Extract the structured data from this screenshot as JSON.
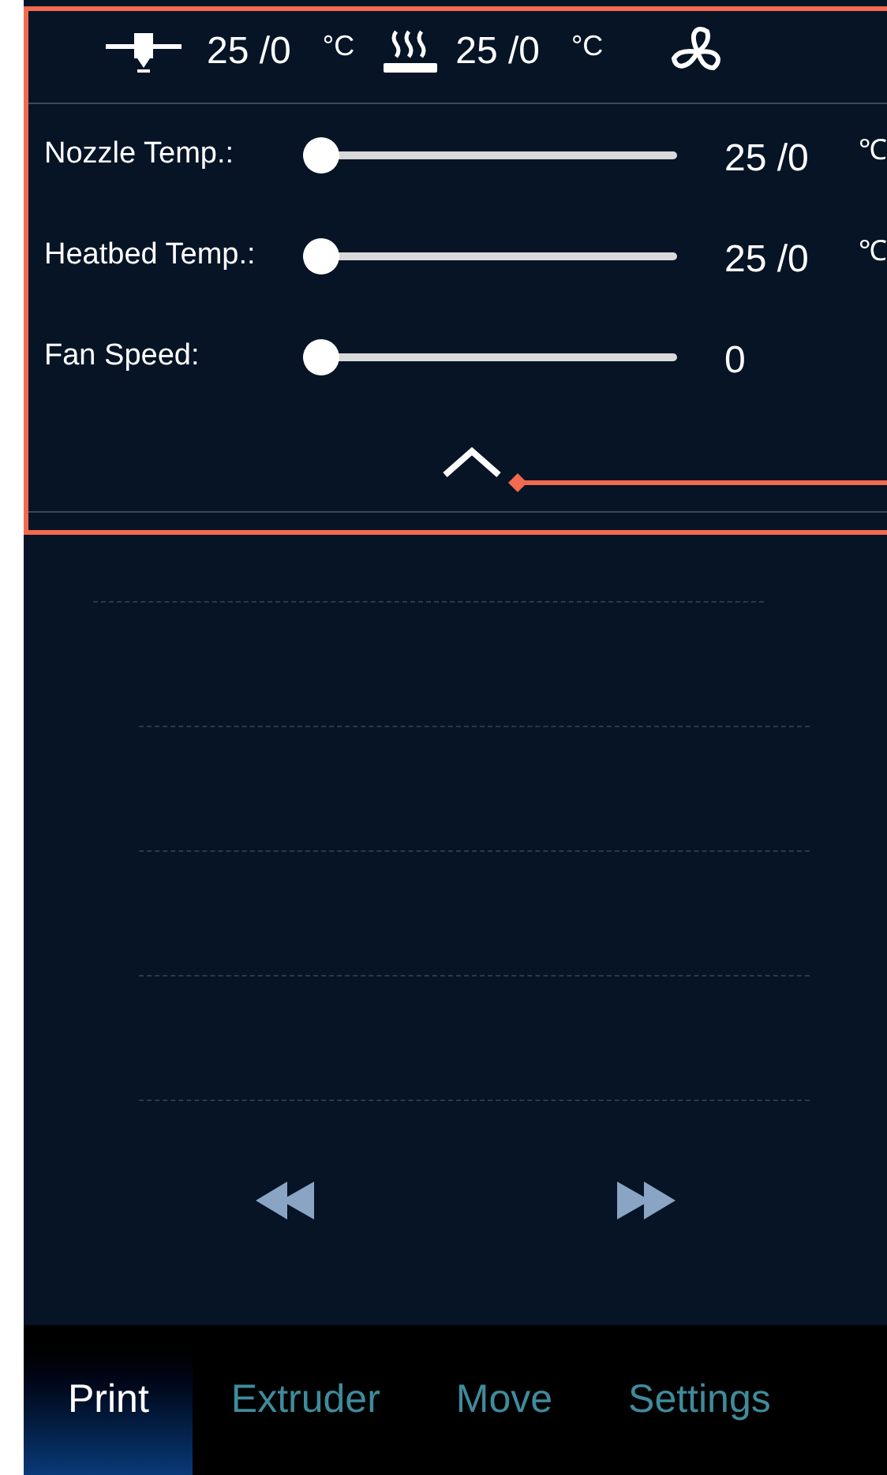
{
  "status": {
    "nozzle": {
      "value": "25 /0",
      "unit": "°C"
    },
    "bed": {
      "value": "25 /0",
      "unit": "°C"
    }
  },
  "sliders": [
    {
      "label": "Nozzle Temp.:",
      "level": 0,
      "value": "25 /0",
      "unit": "℃"
    },
    {
      "label": "Heatbed Temp.:",
      "level": 0,
      "value": "25 /0",
      "unit": "℃"
    },
    {
      "label": "Fan Speed:",
      "level": 0,
      "value": "0"
    }
  ],
  "tabs": [
    {
      "label": "Print",
      "selected": true
    },
    {
      "label": "Extruder",
      "selected": false
    },
    {
      "label": "Move",
      "selected": false
    },
    {
      "label": "Settings",
      "selected": false
    }
  ]
}
